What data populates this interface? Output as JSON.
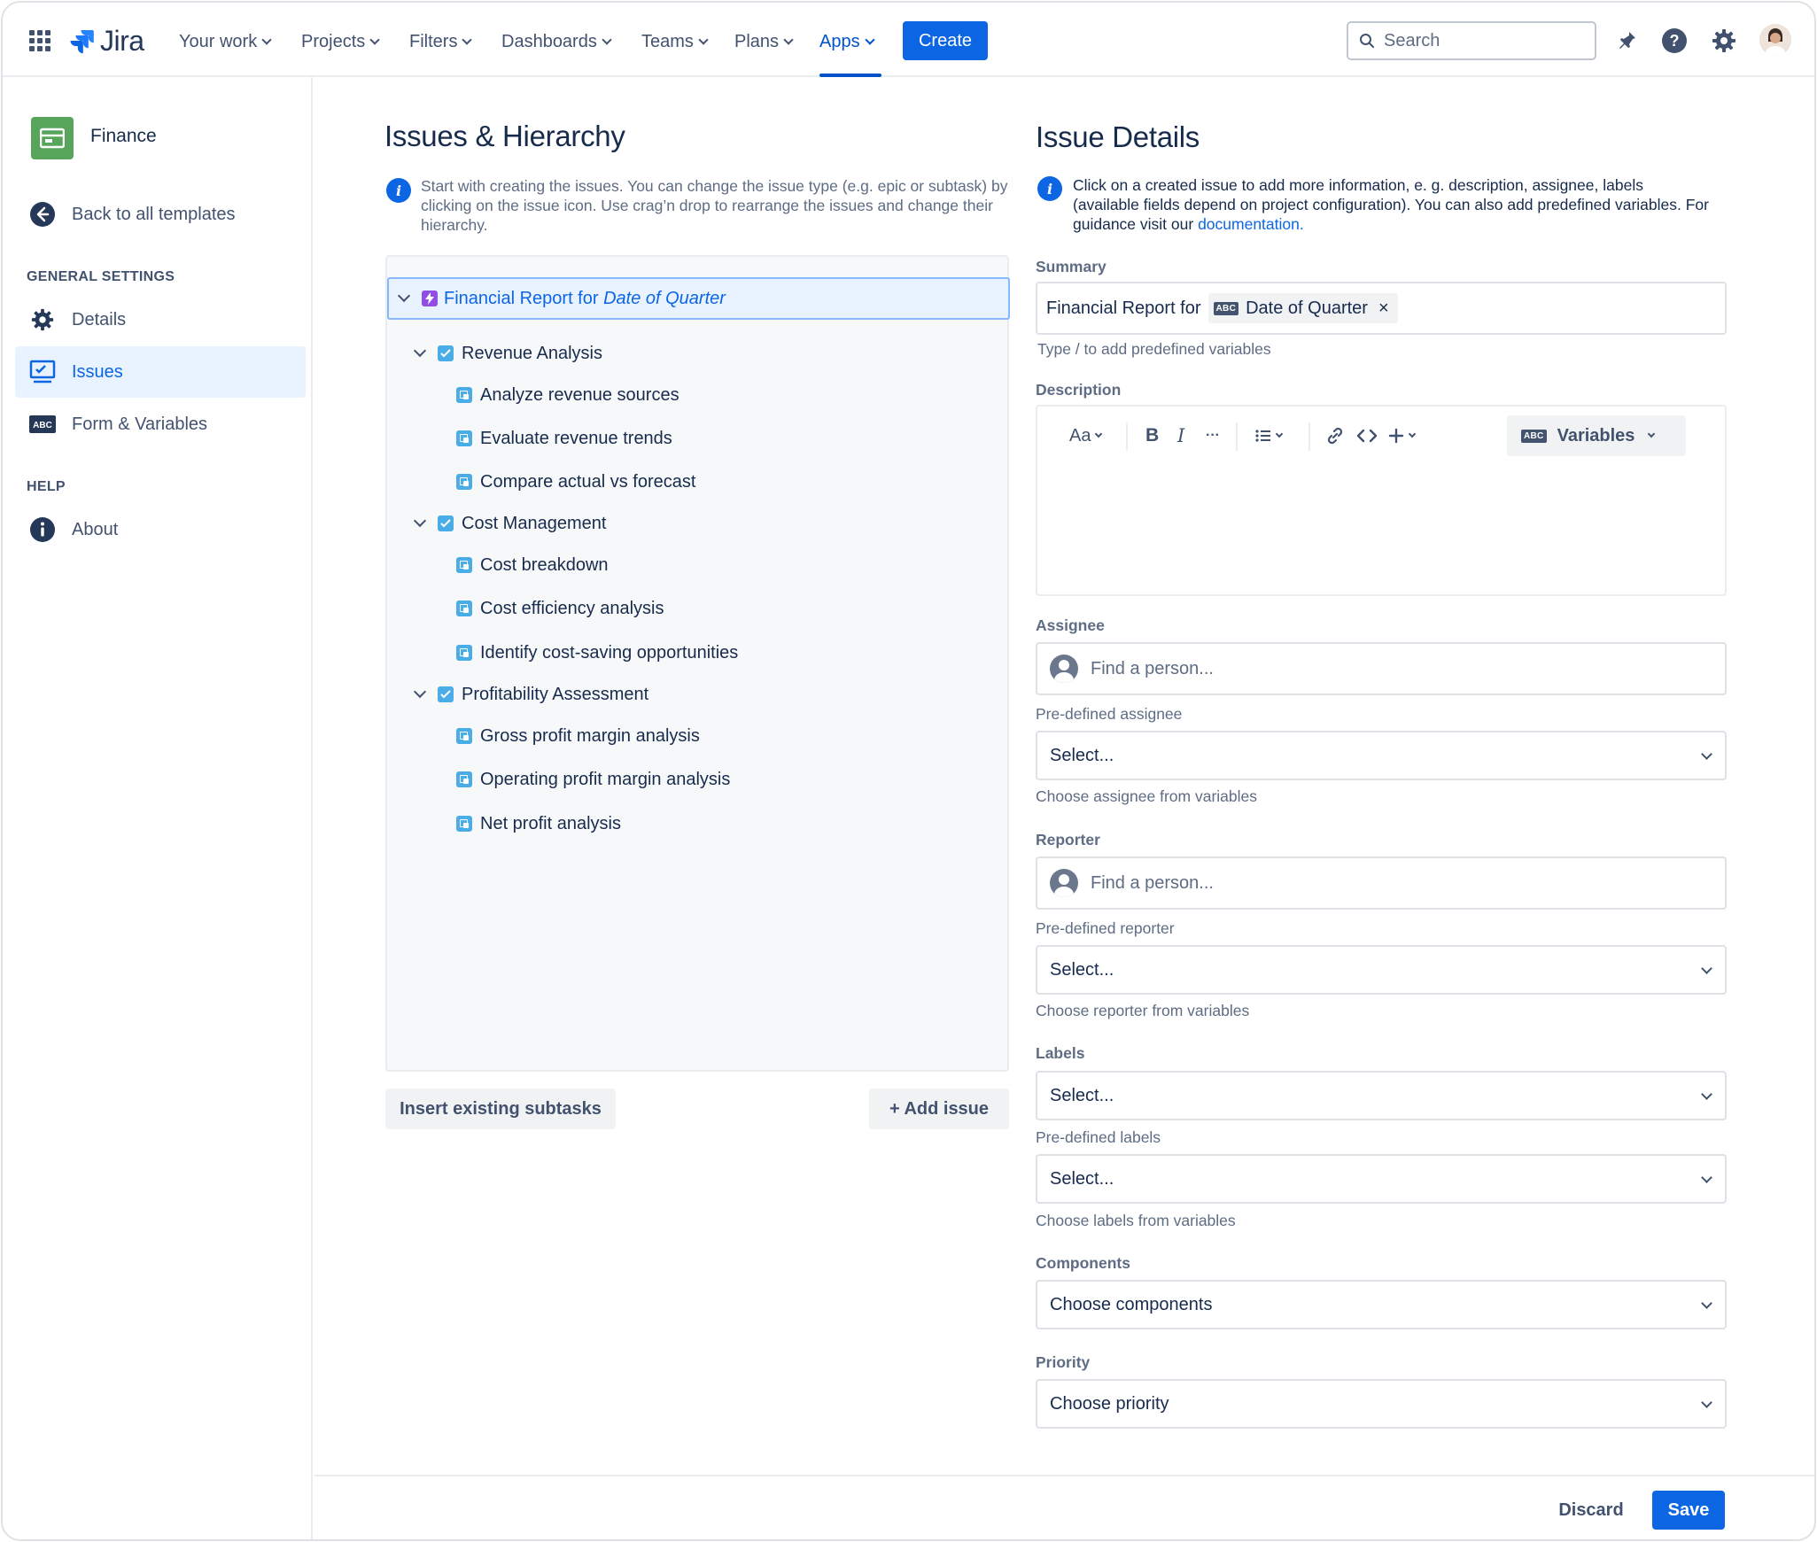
{
  "nav": {
    "logo_text": "Jira",
    "items": [
      {
        "label": "Your work"
      },
      {
        "label": "Projects"
      },
      {
        "label": "Filters"
      },
      {
        "label": "Dashboards"
      },
      {
        "label": "Teams"
      },
      {
        "label": "Plans"
      },
      {
        "label": "Apps",
        "active": true
      }
    ],
    "create_label": "Create",
    "search_placeholder": "Search"
  },
  "sidebar": {
    "project_name": "Finance",
    "back_label": "Back to all templates",
    "general_heading": "GENERAL SETTINGS",
    "items": [
      {
        "label": "Details",
        "icon": "gear-icon"
      },
      {
        "label": "Issues",
        "icon": "monitor-icon",
        "selected": true
      },
      {
        "label": "Form & Variables",
        "icon": "abc-icon"
      }
    ],
    "help_heading": "HELP",
    "about_label": "About"
  },
  "hierarchy": {
    "title": "Issues & Hierarchy",
    "info": "Start with creating the issues. You can change the issue type (e.g. epic or subtask) by clicking on the issue icon. Use crag’n drop to rearrange the issues and change their hierarchy.",
    "root": {
      "prefix": "Financial Report for ",
      "variable": "Date of Quarter"
    },
    "groups": [
      {
        "label": "Revenue Analysis",
        "children": [
          "Analyze revenue sources",
          "Evaluate revenue trends",
          "Compare actual vs forecast"
        ]
      },
      {
        "label": "Cost Management",
        "children": [
          "Cost breakdown",
          "Cost efficiency analysis",
          "Identify cost-saving opportunities"
        ]
      },
      {
        "label": "Profitability Assessment",
        "children": [
          "Gross profit margin analysis",
          "Operating profit margin analysis",
          "Net profit analysis"
        ]
      }
    ],
    "insert_label": "Insert existing subtasks",
    "add_label": "+ Add issue"
  },
  "details": {
    "title": "Issue Details",
    "info_before": "Click on a created issue to add more information, e. g. description, assignee, labels (available fields depend on project configuration). You can also add predefined variables. For guidance visit our ",
    "info_link": "documentation.",
    "summary_label": "Summary",
    "summary_prefix": "Financial Report for",
    "summary_chip": "Date of Quarter",
    "summary_chip_tag": "ABC",
    "summary_hint": "Type / to add predefined variables",
    "description_label": "Description",
    "editor": {
      "text_style": "Aa",
      "bold": "B",
      "italic": "I",
      "more": "···",
      "variables_label": "Variables",
      "variables_tag": "ABC"
    },
    "assignee_label": "Assignee",
    "assignee_placeholder": "Find a person...",
    "predef_assignee_label": "Pre-defined assignee",
    "predef_assignee_value": "Select...",
    "assignee_hint": "Choose assignee from variables",
    "reporter_label": "Reporter",
    "reporter_placeholder": "Find a person...",
    "predef_reporter_label": "Pre-defined reporter",
    "predef_reporter_value": "Select...",
    "reporter_hint": "Choose reporter from variables",
    "labels_label": "Labels",
    "labels_value": "Select...",
    "predef_labels_label": "Pre-defined labels",
    "predef_labels_value": "Select...",
    "labels_hint": "Choose labels from variables",
    "components_label": "Components",
    "components_value": "Choose components",
    "priority_label": "Priority",
    "priority_value": "Choose priority"
  },
  "footer": {
    "discard_label": "Discard",
    "save_label": "Save"
  },
  "colors": {
    "brand": "#0c66e4",
    "selected_bg": "#e9f2ff",
    "project_icon": "#57a55a",
    "epic": "#904ee2",
    "story": "#4bade8"
  }
}
